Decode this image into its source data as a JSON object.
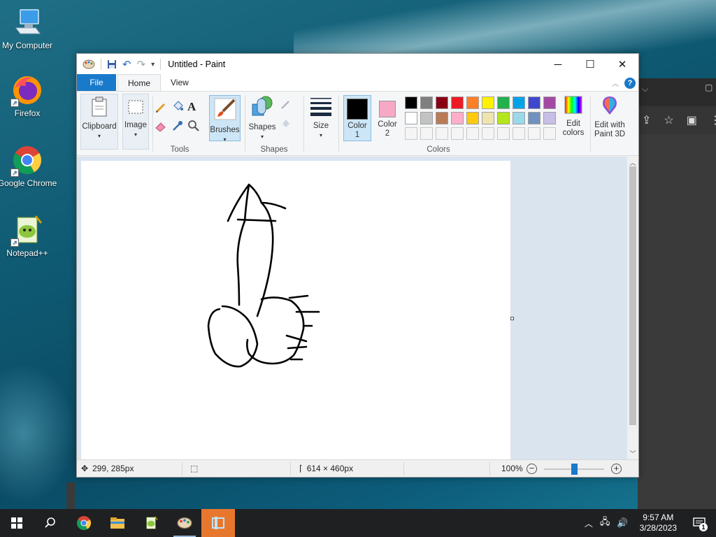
{
  "desktop": {
    "icons": [
      {
        "label": "My Computer"
      },
      {
        "label": "Firefox"
      },
      {
        "label": "Google Chrome"
      },
      {
        "label": "Notepad++"
      }
    ]
  },
  "paint": {
    "title": "Untitled - Paint",
    "tabs": {
      "file": "File",
      "home": "Home",
      "view": "View"
    },
    "help": "?",
    "ribbon": {
      "clipboard": "Clipboard",
      "image": "Image",
      "tools_group": "Tools",
      "brushes": "Brushes",
      "shapes": "Shapes",
      "shapes_group": "Shapes",
      "size": "Size",
      "color1": "Color\n1",
      "color1_line1": "Color",
      "color1_line2": "1",
      "color2_line1": "Color",
      "color2_line2": "2",
      "colors_group": "Colors",
      "edit_colors_line1": "Edit",
      "edit_colors_line2": "colors",
      "paint3d_line1": "Edit with",
      "paint3d_line2": "Paint 3D"
    },
    "colors": {
      "color1": "#000000",
      "color2": "#f6a8c5",
      "palette_row1": [
        "#000000",
        "#7f7f7f",
        "#880015",
        "#ed1c24",
        "#ff7f27",
        "#fff200",
        "#22b14c",
        "#00a2e8",
        "#3f48cc",
        "#a349a4"
      ],
      "palette_row2": [
        "#ffffff",
        "#c3c3c3",
        "#b97a57",
        "#ffaec9",
        "#ffc90e",
        "#efe4b0",
        "#b5e61d",
        "#99d9ea",
        "#7092be",
        "#c8bfe7"
      ]
    },
    "status": {
      "cursor_pos": "299, 285px",
      "image_size": "614 × 460px",
      "zoom": "100%"
    }
  },
  "taskbar": {
    "time": "9:57 AM",
    "date": "3/28/2023",
    "notification_count": "1"
  }
}
